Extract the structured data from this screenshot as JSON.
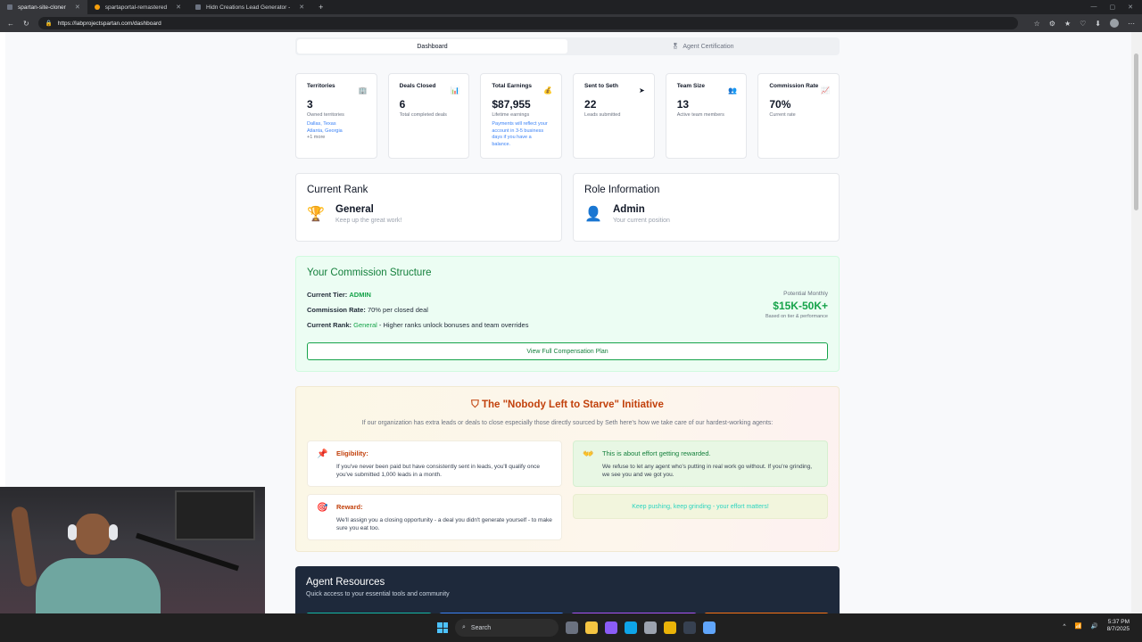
{
  "browser": {
    "tabs": [
      {
        "title": "spartan-site-cloner",
        "active": true
      },
      {
        "title": "spartaportal-remastered",
        "active": false
      },
      {
        "title": "Hidn Creations Lead Generator -",
        "active": false
      }
    ],
    "url": "https://labprojectspartan.com/dashboard"
  },
  "nav_tabs": {
    "dashboard": "Dashboard",
    "certification": "Agent Certification"
  },
  "stats": [
    {
      "label": "Territories",
      "icon": "building-icon",
      "value": "3",
      "sub": "Owned territories",
      "extra": [
        "Dallas, Texas",
        "Atlanta, Georgia"
      ],
      "more": "+1 more"
    },
    {
      "label": "Deals Closed",
      "icon": "chart-icon",
      "value": "6",
      "sub": "Total completed deals"
    },
    {
      "label": "Total Earnings",
      "icon": "money-bag-icon",
      "value": "$87,955",
      "sub": "Lifetime earnings",
      "note": "Payments will reflect your account in 3-5 business days if you have a balance."
    },
    {
      "label": "Sent to Seth",
      "icon": "send-icon",
      "value": "22",
      "sub": "Leads submitted"
    },
    {
      "label": "Team Size",
      "icon": "team-icon",
      "value": "13",
      "sub": "Active team members"
    },
    {
      "label": "Commission Rate",
      "icon": "rate-chart-icon",
      "value": "70%",
      "sub": "Current rate"
    }
  ],
  "rank": {
    "title": "Current Rank",
    "name": "General",
    "desc": "Keep up the great work!"
  },
  "role": {
    "title": "Role Information",
    "name": "Admin",
    "desc": "Your current position"
  },
  "commission": {
    "title": "Your Commission Structure",
    "tier_label": "Current Tier:",
    "tier_value": "ADMIN",
    "rate_label": "Commission Rate:",
    "rate_value": "70% per closed deal",
    "rank_label": "Current Rank:",
    "rank_value": "General",
    "rank_suffix": "- Higher ranks unlock bonuses and team overrides",
    "potential_label": "Potential Monthly",
    "potential_value": "$15K-50K+",
    "potential_sub": "Based on tier & performance",
    "button": "View Full Compensation Plan"
  },
  "initiative": {
    "title": "The \"Nobody Left to Starve\" Initiative",
    "intro": "If our organization has extra leads or deals to close especially those directly sourced by Seth here's how we take care of our hardest-working agents:",
    "eligibility_title": "Eligibility:",
    "eligibility_text": "If you've never been paid but have consistently sent in leads, you'll qualify once you've submitted 1,000 leads in a month.",
    "effort_title": "This is about effort getting rewarded.",
    "effort_text": "We refuse to let any agent who's putting in real work go without. If you're grinding, we see you and we got you.",
    "reward_title": "Reward:",
    "reward_text": "We'll assign you a closing opportunity - a deal you didn't generate yourself - to make sure you eat too.",
    "pill": "Keep pushing, keep grinding - your effort matters!"
  },
  "resources": {
    "title": "Agent Resources",
    "sub": "Quick access to your essential tools and community",
    "tile_colors": [
      "#14b8a6",
      "#3b82f6",
      "#a855f7",
      "#f97316"
    ]
  },
  "taskbar": {
    "search": "Search",
    "time": "5:37 PM",
    "date": "8/7/2025"
  }
}
